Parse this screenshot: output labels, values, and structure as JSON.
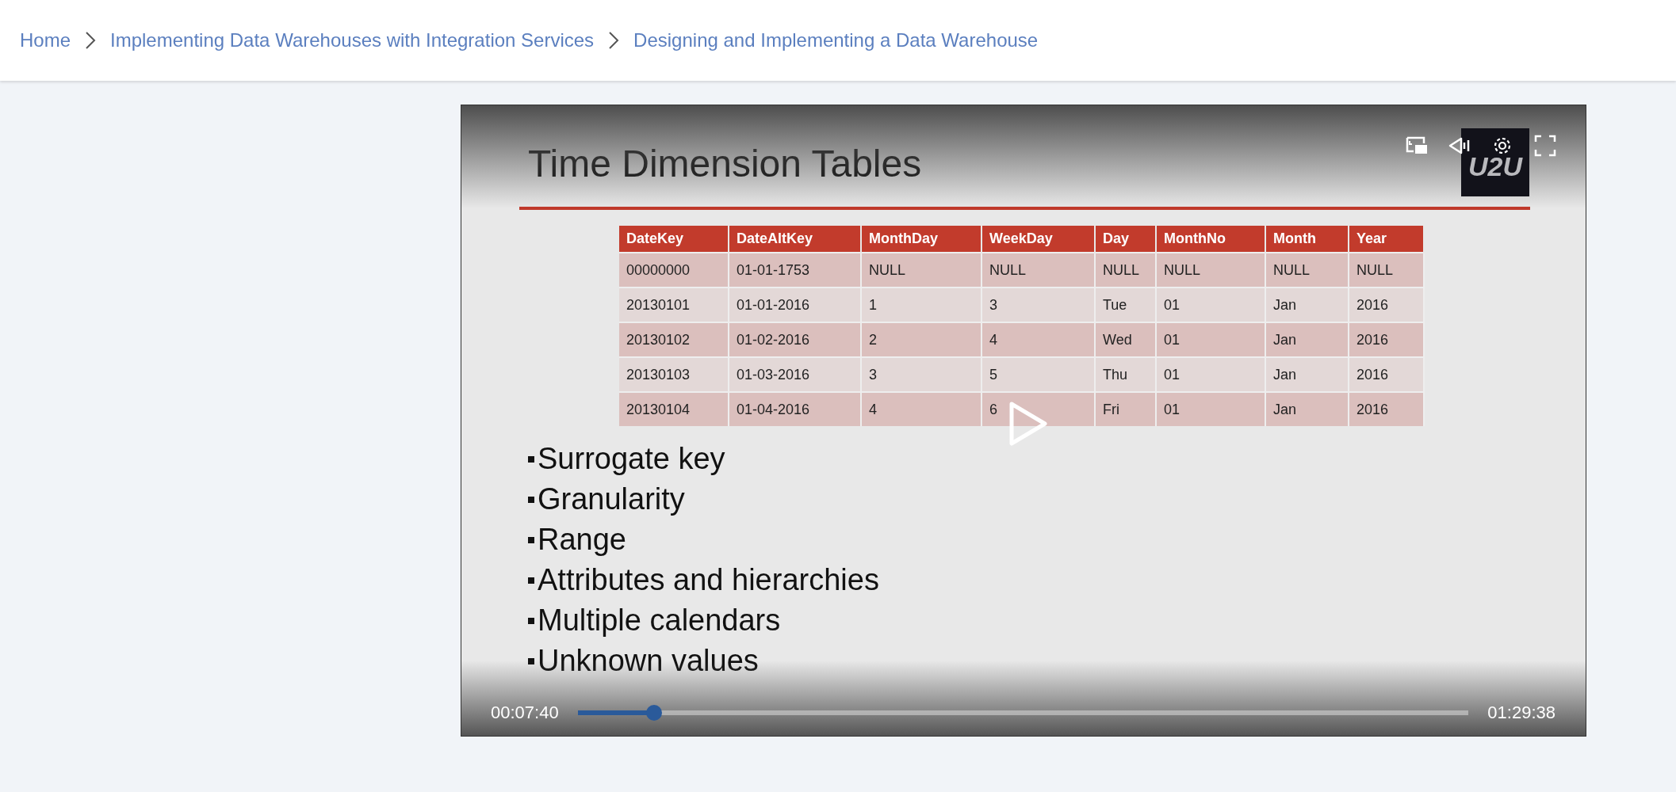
{
  "breadcrumb": [
    {
      "label": "Home"
    },
    {
      "label": "Implementing Data Warehouses with Integration Services"
    },
    {
      "label": "Designing and Implementing a Data Warehouse"
    }
  ],
  "video": {
    "slide": {
      "title": "Time Dimension Tables",
      "logo": "U2U",
      "table": {
        "columns": [
          "DateKey",
          "DateAltKey",
          "MonthDay",
          "WeekDay",
          "Day",
          "MonthNo",
          "Month",
          "Year"
        ],
        "rows": [
          [
            "00000000",
            "01-01-1753",
            "NULL",
            "NULL",
            "NULL",
            "NULL",
            "NULL",
            "NULL"
          ],
          [
            "20130101",
            "01-01-2016",
            "1",
            "3",
            "Tue",
            "01",
            "Jan",
            "2016"
          ],
          [
            "20130102",
            "01-02-2016",
            "2",
            "4",
            "Wed",
            "01",
            "Jan",
            "2016"
          ],
          [
            "20130103",
            "01-03-2016",
            "3",
            "5",
            "Thu",
            "01",
            "Jan",
            "2016"
          ],
          [
            "20130104",
            "01-04-2016",
            "4",
            "6",
            "Fri",
            "01",
            "Jan",
            "2016"
          ]
        ]
      },
      "bullets": [
        "Surrogate key",
        "Granularity",
        "Range",
        "Attributes and hierarchies",
        "Multiple calendars",
        "Unknown values"
      ]
    },
    "controls": {
      "current_time": "00:07:40",
      "duration": "01:29:38",
      "progress": {
        "level": 0.086
      }
    }
  }
}
